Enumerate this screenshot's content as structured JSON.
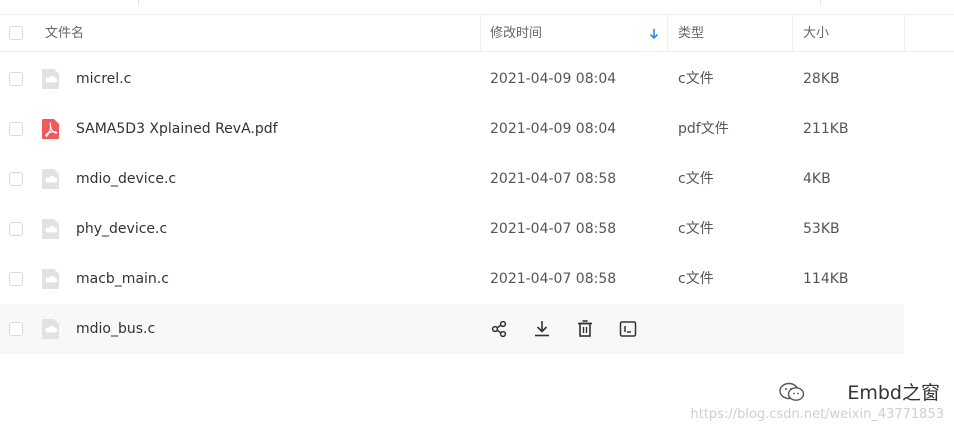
{
  "header": {
    "name_label": "文件名",
    "time_label": "修改时间",
    "type_label": "类型",
    "size_label": "大小",
    "sort": "descending"
  },
  "files": [
    {
      "name": "micrel.c",
      "time": "2021-04-09 08:04",
      "type": "c文件",
      "size": "28KB",
      "icon": "file-generic-icon"
    },
    {
      "name": "SAMA5D3 Xplained RevA.pdf",
      "time": "2021-04-09 08:04",
      "type": "pdf文件",
      "size": "211KB",
      "icon": "pdf-icon"
    },
    {
      "name": "mdio_device.c",
      "time": "2021-04-07 08:58",
      "type": "c文件",
      "size": "4KB",
      "icon": "file-generic-icon"
    },
    {
      "name": "phy_device.c",
      "time": "2021-04-07 08:58",
      "type": "c文件",
      "size": "53KB",
      "icon": "file-generic-icon"
    },
    {
      "name": "macb_main.c",
      "time": "2021-04-07 08:58",
      "type": "c文件",
      "size": "114KB",
      "icon": "file-generic-icon"
    },
    {
      "name": "mdio_bus.c",
      "icon": "file-generic-icon",
      "hovered": true,
      "actions": [
        "share-icon",
        "download-icon",
        "delete-icon",
        "rename-icon"
      ]
    }
  ],
  "watermark": {
    "brand": "Embd之窗",
    "url": "https://blog.csdn.net/weixin_43771853"
  },
  "colors": {
    "sort_arrow": "#2a8cf0",
    "pdf": "#f25a5a",
    "file_icon": "#e2e2e2",
    "hover_row": "#f7f8fa"
  }
}
